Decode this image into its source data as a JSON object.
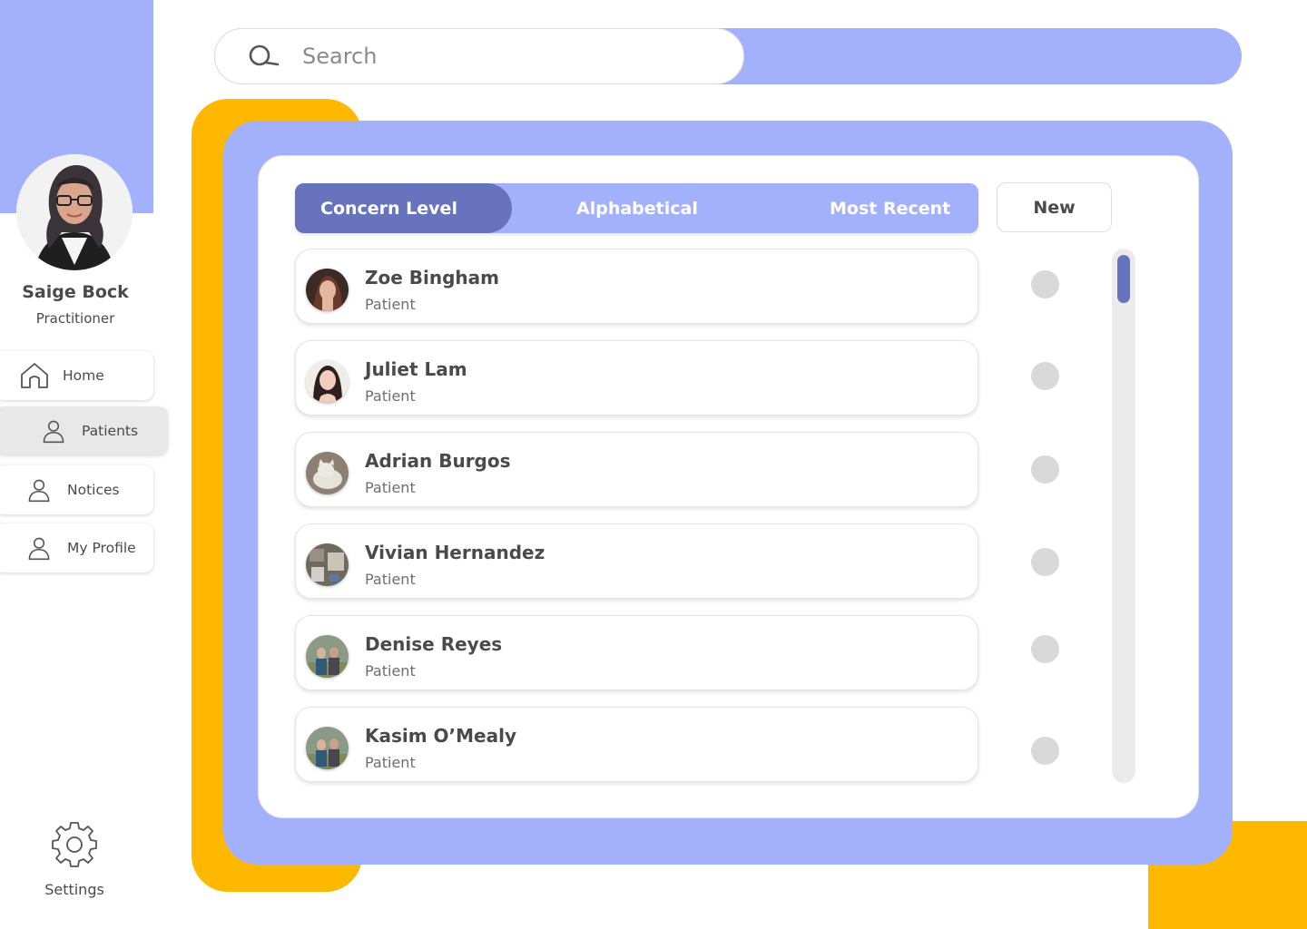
{
  "search": {
    "placeholder": "Search"
  },
  "user": {
    "name": "Saige Bock",
    "role": "Practitioner"
  },
  "nav": {
    "home": "Home",
    "patients": "Patients",
    "notices": "Notices",
    "profile": "My Profile",
    "settings": "Settings"
  },
  "sort_tabs": {
    "concern": "Concern Level",
    "alphabetical": "Alphabetical",
    "recent": "Most Recent",
    "active": "Concern Level"
  },
  "new_button": "New",
  "patients": [
    {
      "name": "Zoe Bingham",
      "role": "Patient"
    },
    {
      "name": "Juliet Lam",
      "role": "Patient"
    },
    {
      "name": "Adrian Burgos",
      "role": "Patient"
    },
    {
      "name": "Vivian Hernandez",
      "role": "Patient"
    },
    {
      "name": "Denise Reyes",
      "role": "Patient"
    },
    {
      "name": "Kasim O’Mealy",
      "role": "Patient"
    }
  ],
  "colors": {
    "accent_periwinkle": "#a3b1fd",
    "accent_indigo": "#6773bd",
    "accent_yellow": "#ffb800",
    "status_dot": "#d9d9d9"
  },
  "icons": {
    "search": "search-icon",
    "home": "home-icon",
    "person": "person-icon",
    "settings": "gear-icon"
  }
}
